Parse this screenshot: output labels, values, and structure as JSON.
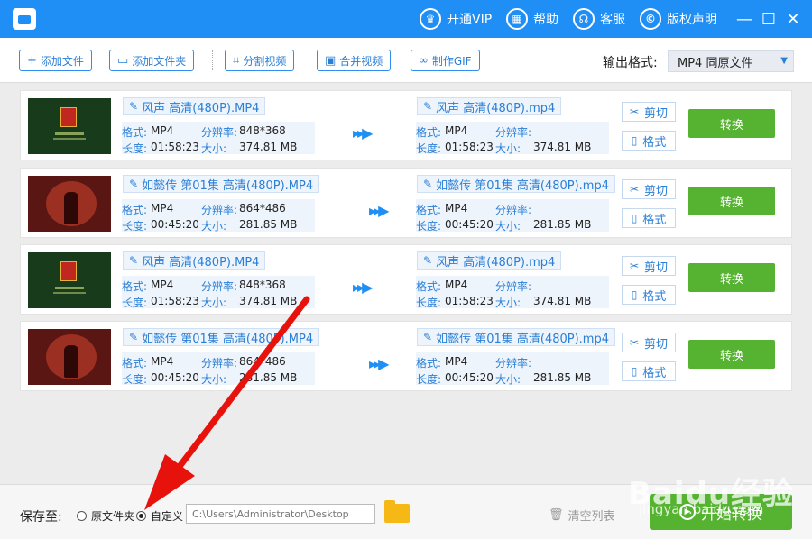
{
  "titlebar": {
    "vip": "开通VIP",
    "help": "帮助",
    "service": "客服",
    "copyright": "版权声明"
  },
  "toolbar": {
    "add_file": "添加文件",
    "add_folder": "添加文件夹",
    "split_video": "分割视频",
    "merge_video": "合并视频",
    "make_gif": "制作GIF",
    "format_label": "输出格式:",
    "format_value": "MP4  同原文件"
  },
  "labels": {
    "format": "格式:",
    "resolution": "分辨率:",
    "duration": "长度:",
    "size": "大小:",
    "cut": "剪切",
    "fmt": "格式",
    "convert": "转换"
  },
  "files": [
    {
      "thumb": "green",
      "src_name": "风声 高清(480P).MP4",
      "src_format": "MP4",
      "src_res": "848*368",
      "src_len": "01:58:23",
      "src_size": "374.81 MB",
      "dst_name": "风声 高清(480P).mp4",
      "dst_format": "MP4",
      "dst_res": "",
      "dst_len": "01:58:23",
      "dst_size": "374.81 MB"
    },
    {
      "thumb": "red",
      "src_name": "如懿传 第01集 高清(480P).MP4",
      "src_format": "MP4",
      "src_res": "864*486",
      "src_len": "00:45:20",
      "src_size": "281.85 MB",
      "dst_name": "如懿传 第01集 高清(480P).mp4",
      "dst_format": "MP4",
      "dst_res": "",
      "dst_len": "00:45:20",
      "dst_size": "281.85 MB"
    },
    {
      "thumb": "green",
      "src_name": "风声 高清(480P).MP4",
      "src_format": "MP4",
      "src_res": "848*368",
      "src_len": "01:58:23",
      "src_size": "374.81 MB",
      "dst_name": "风声 高清(480P).mp4",
      "dst_format": "MP4",
      "dst_res": "",
      "dst_len": "01:58:23",
      "dst_size": "374.81 MB"
    },
    {
      "thumb": "red",
      "src_name": "如懿传 第01集 高清(480P).MP4",
      "src_format": "MP4",
      "src_res": "864*486",
      "src_len": "00:45:20",
      "src_size": "281.85 MB",
      "dst_name": "如懿传 第01集 高清(480P).mp4",
      "dst_format": "MP4",
      "dst_res": "",
      "dst_len": "00:45:20",
      "dst_size": "281.85 MB"
    }
  ],
  "bottom": {
    "save_to": "保存至:",
    "opt_original": "原文件夹",
    "opt_custom": "自定义",
    "selected": "custom",
    "path": "C:\\Users\\Administrator\\Desktop",
    "clear_list": "清空列表",
    "start": "开始转换"
  },
  "watermark": {
    "brand": "Baidu经验",
    "url": "jingyan.baidu.com"
  },
  "colors": {
    "primary": "#1f8ef5",
    "accent_text": "#2a7fd6",
    "convert_green": "#56b332",
    "annotation_red": "#e8120c"
  },
  "icons": {
    "vip": "vip-crown-icon",
    "help": "help-grid-icon",
    "service": "headset-icon",
    "copyright": "copyright-icon",
    "edit": "pencil-icon",
    "cut": "scissors-icon",
    "format": "file-format-icon",
    "clear": "trash-icon",
    "start": "play-circle-icon",
    "folder": "folder-icon"
  }
}
